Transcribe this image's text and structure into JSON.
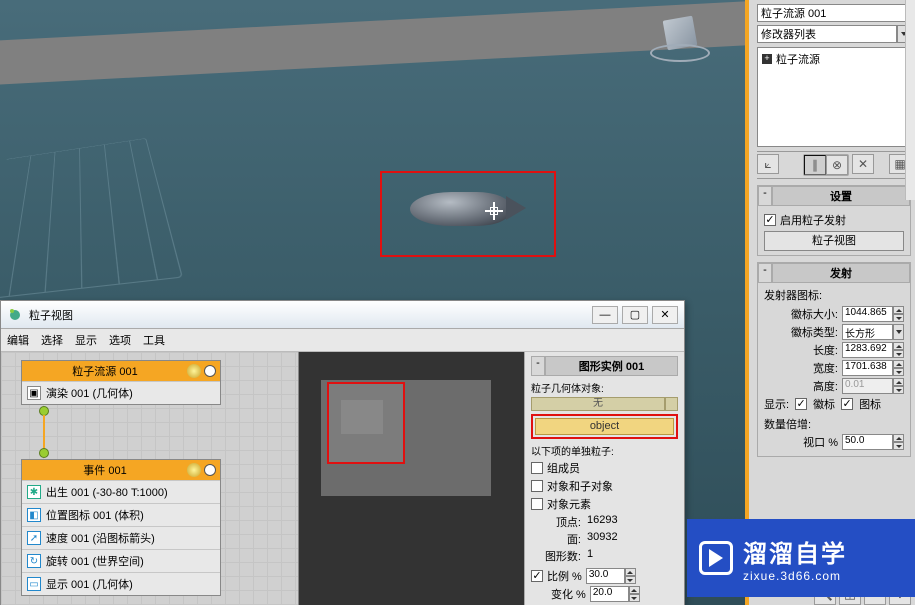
{
  "viewport": {
    "selected_label": ""
  },
  "right": {
    "object_name": "粒子流源 001",
    "mod_list_label": "修改器列表",
    "stack_item": "粒子流源",
    "rollout_settings": {
      "title": "设置",
      "enable": "启用粒子发射",
      "pv_btn": "粒子视图"
    },
    "rollout_emit": {
      "title": "发射",
      "icon_label": "徽标大小:",
      "icon_val": "1044.865",
      "type_label": "徽标类型:",
      "type_val": "长方形",
      "len_label": "长度:",
      "len_val": "1283.692",
      "wid_label": "宽度:",
      "wid_val": "1701.638",
      "hgt_label": "高度:",
      "hgt_val": "0.01",
      "show": "显示:",
      "chk_logo": "徽标",
      "chk_icon": "图标",
      "multiplier": "数量倍增:",
      "viewport_pct": "视口 %",
      "viewport_val": "50.0"
    },
    "emitter_icon_label": "发射器图标:"
  },
  "pview": {
    "title": "粒子视图",
    "menu": {
      "edit": "编辑",
      "select": "选择",
      "display": "显示",
      "options": "选项",
      "tools": "工具"
    },
    "flow_title": "粒子流源 001",
    "render_op": "演染 001 (几何体)",
    "event_title": "事件 001",
    "ops": {
      "birth": "出生 001 (-30-80 T:1000)",
      "pos": "位置图标 001 (体积)",
      "speed": "速度 001 (沿图标箭头)",
      "rot": "旋转 001 (世界空间)",
      "disp": "显示 001 (几何体)"
    },
    "shape_panel": {
      "title": "图形实例 001",
      "geom_label": "粒子几何体对象:",
      "obj_btn": "object",
      "single_label": "以下项的单独粒子:",
      "chk_members": "组成员",
      "chk_children": "对象和子对象",
      "chk_elements": "对象元素",
      "verts_lbl": "顶点:",
      "verts_val": "16293",
      "faces_lbl": "面:",
      "faces_val": "30932",
      "shapes_lbl": "图形数:",
      "shapes_val": "1",
      "scale_lbl": "比例 %",
      "scale_val": "30.0",
      "var_lbl": "变化 %",
      "var_val": "20.0"
    }
  },
  "watermark": {
    "big": "溜溜自学",
    "small": "zixue.3d66.com"
  }
}
